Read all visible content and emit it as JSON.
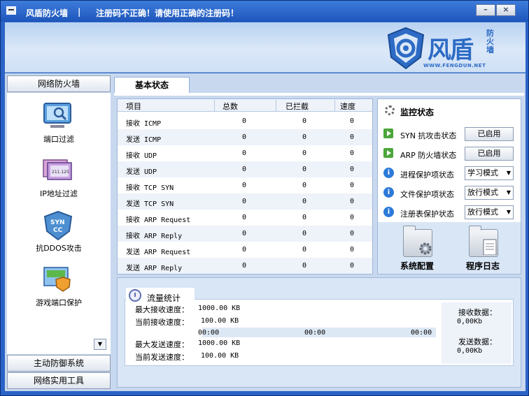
{
  "titlebar": {
    "app_name": "风盾防火墙",
    "separator": "|",
    "message": "注册码不正确！请使用正确的注册码！",
    "minimize": "–",
    "close": "×"
  },
  "logo": {
    "name": "风盾",
    "side": "防火墙",
    "url": "WWW.FENGDUN.NET"
  },
  "sidebar": {
    "header": "网络防火墙",
    "items": [
      {
        "label": "端口过滤",
        "icon": "monitor-search-icon"
      },
      {
        "label": "IP地址过滤",
        "icon": "ip-screen-icon"
      },
      {
        "label": "抗DDOS攻击",
        "icon": "syn-shield-icon"
      },
      {
        "label": "游戏端口保护",
        "icon": "game-shield-icon"
      }
    ],
    "scroll_down": "▼",
    "section2": "主动防御系统",
    "section3": "网络实用工具"
  },
  "tabs": {
    "basic": "基本状态"
  },
  "stat_table": {
    "columns": [
      "项目",
      "总数",
      "已拦截",
      "速度"
    ],
    "rows": [
      {
        "name": "接收 ICMP",
        "total": "0",
        "blocked": "0",
        "speed": "0"
      },
      {
        "name": "发送 ICMP",
        "total": "0",
        "blocked": "0",
        "speed": "0"
      },
      {
        "name": "接收 UDP",
        "total": "0",
        "blocked": "0",
        "speed": "0"
      },
      {
        "name": "发送 UDP",
        "total": "0",
        "blocked": "0",
        "speed": "0"
      },
      {
        "name": "接收 TCP SYN",
        "total": "0",
        "blocked": "0",
        "speed": "0"
      },
      {
        "name": "发送 TCP SYN",
        "total": "0",
        "blocked": "0",
        "speed": "0"
      },
      {
        "name": "接收 ARP Request",
        "total": "0",
        "blocked": "0",
        "speed": "0"
      },
      {
        "name": "接收 ARP Reply",
        "total": "0",
        "blocked": "0",
        "speed": "0"
      },
      {
        "name": "发送 ARP Request",
        "total": "0",
        "blocked": "0",
        "speed": "0"
      },
      {
        "name": "发送 ARP Reply",
        "total": "0",
        "blocked": "0",
        "speed": "0"
      }
    ]
  },
  "monitor": {
    "title": "监控状态",
    "rows": [
      {
        "label": "SYN 抗攻击状态",
        "value": "已启用",
        "kind": "button"
      },
      {
        "label": "ARP 防火墙状态",
        "value": "已启用",
        "kind": "button"
      },
      {
        "label": "进程保护项状态",
        "value": "学习模式",
        "kind": "select"
      },
      {
        "label": "文件保护项状态",
        "value": "放行模式",
        "kind": "select"
      },
      {
        "label": "注册表保护状态",
        "value": "放行模式",
        "kind": "select"
      }
    ],
    "tool_config": "系统配置",
    "tool_log": "程序日志"
  },
  "traffic": {
    "title": "流量统计",
    "max_recv_label": "最大接收速度：",
    "max_recv_value": "1000.00 KB",
    "cur_recv_label": "当前接收速度：",
    "cur_recv_value": "100.00 KB",
    "time_labels": [
      "00:00",
      "00:00",
      "00:00"
    ],
    "max_send_label": "最大发送速度：",
    "max_send_value": "1000.00 KB",
    "cur_send_label": "当前发送速度：",
    "cur_send_value": "100.00 KB",
    "recv_data_label": "接收数据：",
    "recv_data_value": "0,00Kb",
    "send_data_label": "发送数据：",
    "send_data_value": "0,00Kb"
  },
  "colors": {
    "frame": "#2b63c6",
    "panel": "#c8d8ee",
    "accent": "#2d6bc5"
  }
}
